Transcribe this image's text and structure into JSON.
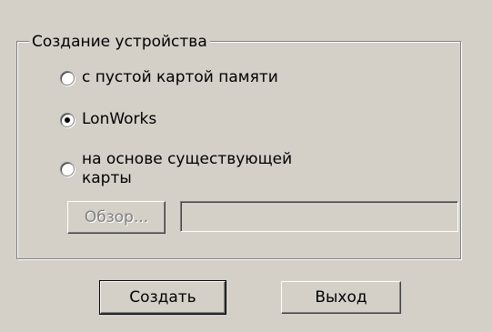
{
  "group": {
    "title": "Создание устройства",
    "options": [
      {
        "label": "с пустой картой памяти",
        "checked": false
      },
      {
        "label": "LonWorks",
        "checked": true
      },
      {
        "label_line1": "на основе существующей",
        "label_line2": "карты",
        "checked": false
      }
    ],
    "browse_button": "Обзор...",
    "path_value": ""
  },
  "buttons": {
    "create": "Создать",
    "exit": "Выход"
  }
}
